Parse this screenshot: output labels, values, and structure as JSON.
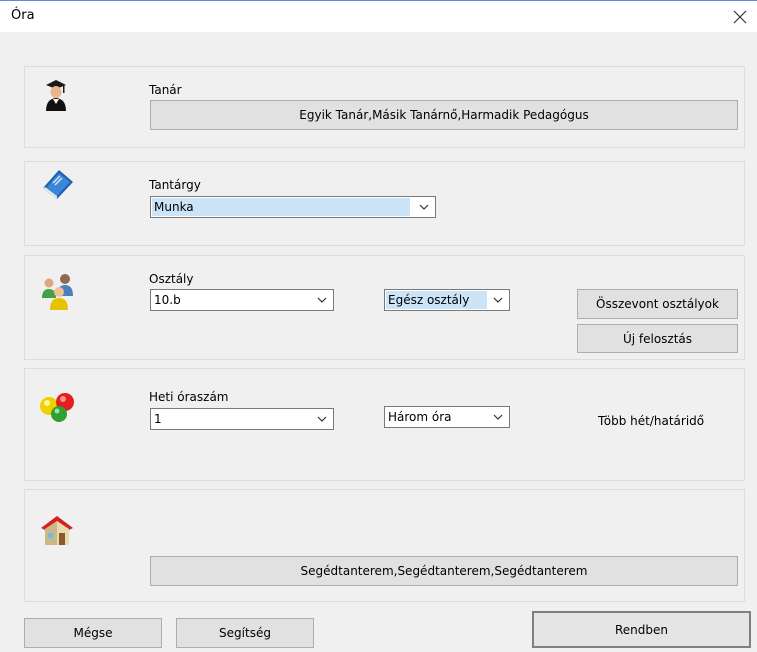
{
  "window": {
    "title": "Óra"
  },
  "teacher": {
    "label": "Tanár",
    "button": "Egyik Tanár,Másik Tanárnő,Harmadik Pedagógus"
  },
  "subject": {
    "label": "Tantárgy",
    "value": "Munka"
  },
  "class": {
    "label": "Osztály",
    "value": "10.b",
    "group_value": "Egész osztály",
    "merged_button": "Összevont osztályok",
    "new_split_button": "Új felosztás"
  },
  "hours": {
    "label": "Heti óraszám",
    "value": "1",
    "hours_value": "Három óra",
    "multi_week": "Több hét/határidő"
  },
  "room": {
    "button": "Segédtanterem,Segédtanterem,Segédtanterem"
  },
  "footer": {
    "cancel": "Mégse",
    "help": "Segítség",
    "ok": "Rendben"
  },
  "colors": {
    "selection": "#cce4f7",
    "title_border": "#5a8fd6"
  },
  "icons": {
    "teacher": "graduate-icon",
    "subject": "book-icon",
    "class": "group-icon",
    "hours": "balls-icon",
    "room": "house-icon"
  }
}
